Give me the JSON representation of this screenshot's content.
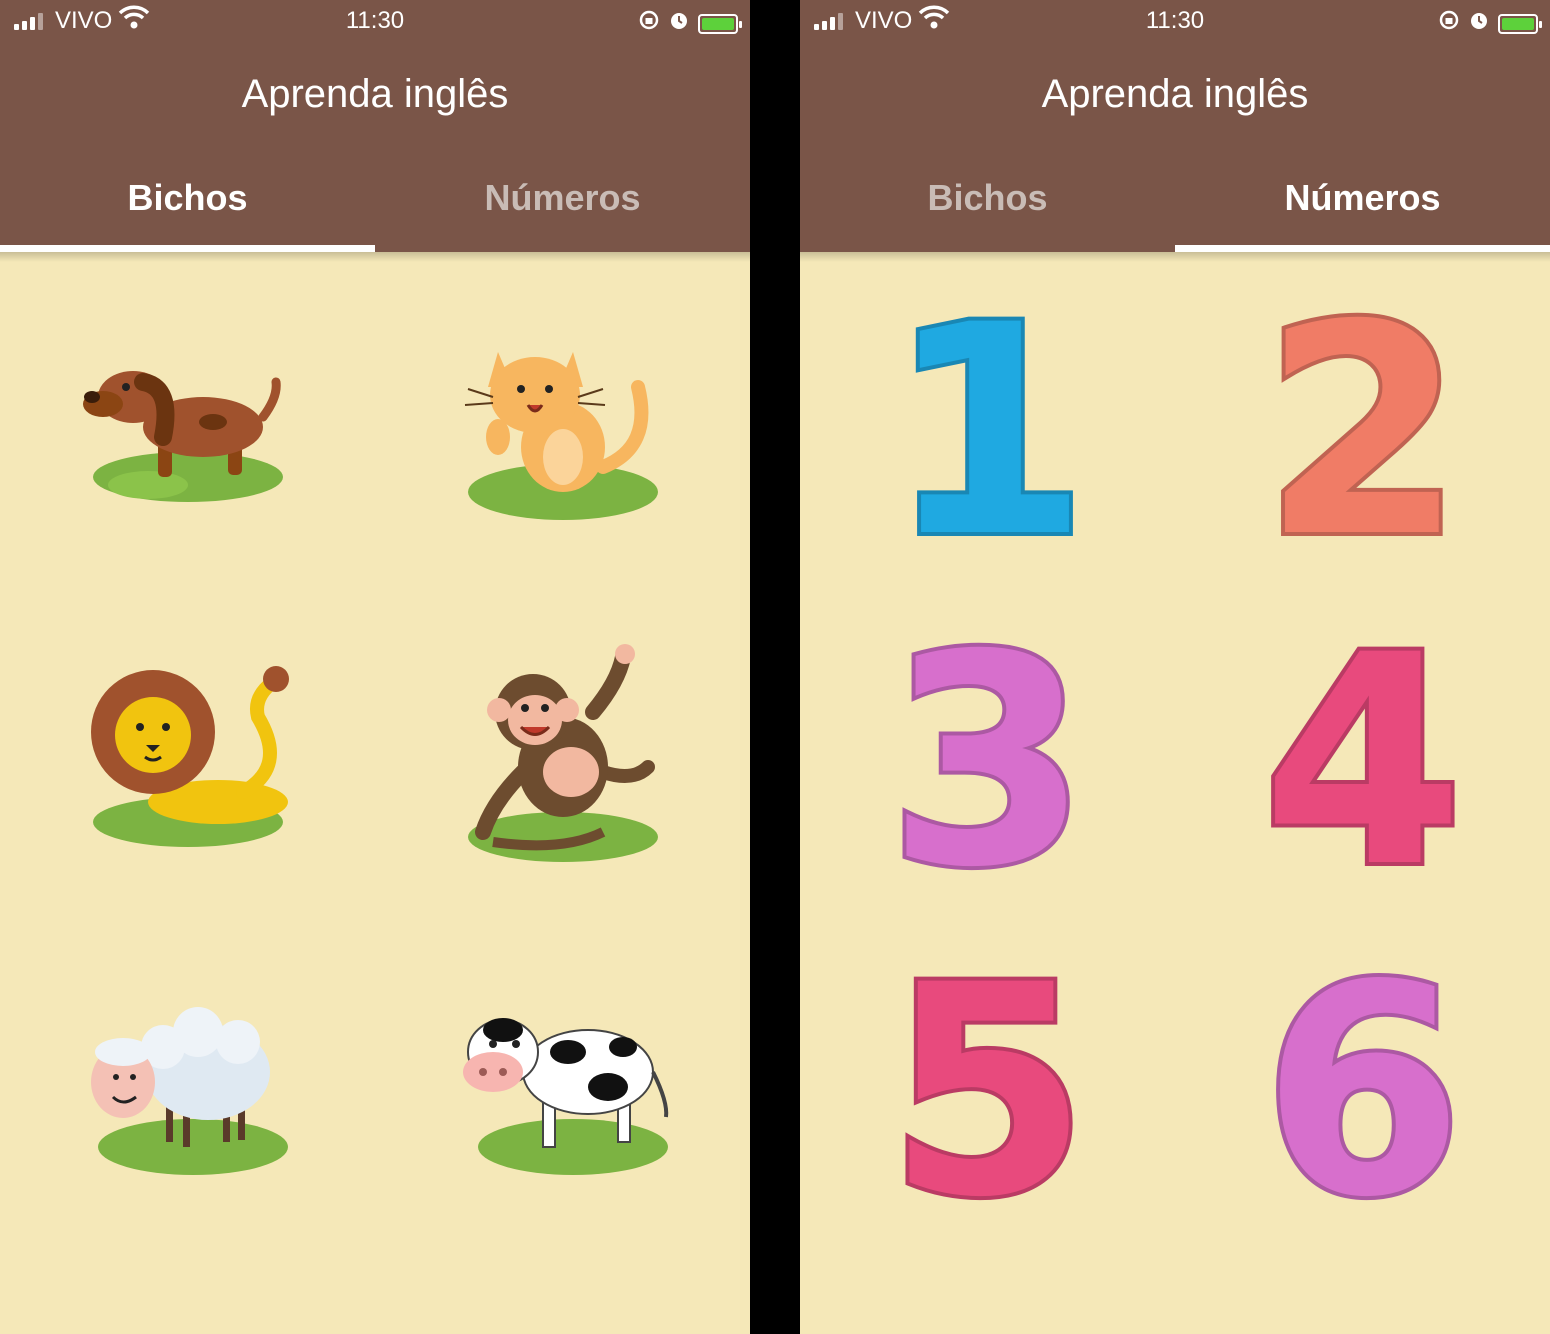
{
  "status": {
    "carrier": "VIVO",
    "time": "11:30"
  },
  "app": {
    "title": "Aprenda inglês"
  },
  "tabs": {
    "bichos": "Bichos",
    "numeros": "Números"
  },
  "animals": [
    "dog",
    "cat",
    "lion",
    "monkey",
    "sheep",
    "cow"
  ],
  "numbers": {
    "labels": [
      "1",
      "2",
      "3",
      "4",
      "5",
      "6"
    ],
    "colors": [
      "#1fa9e1",
      "#f07c66",
      "#d76fcc",
      "#e84a7d",
      "#e84a7d",
      "#d76fcc"
    ]
  },
  "colors": {
    "appbar": "#7a5548",
    "background": "#f5e8b8",
    "indicator": "#ffffff",
    "grass": "#7cb342"
  }
}
